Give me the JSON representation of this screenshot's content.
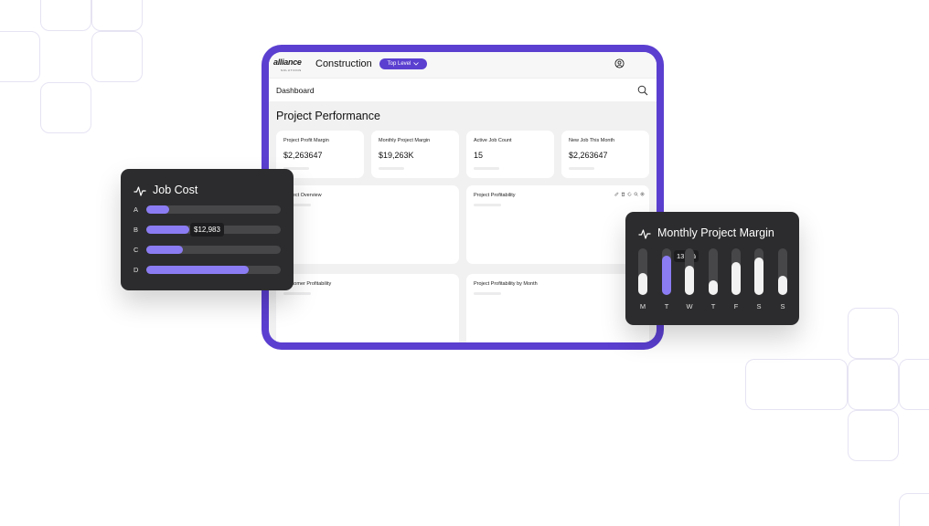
{
  "app": {
    "logo_text": "alliance",
    "logo_subtext": "SOLUTIONS",
    "title": "Construction",
    "level_selector": "Top Level",
    "breadcrumb": "Dashboard",
    "page_title": "Project Performance"
  },
  "kpis": [
    {
      "label": "Project Profit Margin",
      "value": "$2,263647"
    },
    {
      "label": "Monthly Project Margin",
      "value": "$19,263K"
    },
    {
      "label": "Active Job Count",
      "value": "15"
    },
    {
      "label": "New Job This Month",
      "value": "$2,263647"
    }
  ],
  "panels": [
    {
      "title": "Project Overview"
    },
    {
      "title": "Project Profitability"
    },
    {
      "title": "Customer Profitability"
    },
    {
      "title": "Project Profitability by Month"
    }
  ],
  "job_cost": {
    "title": "Job Cost",
    "rows": [
      {
        "label": "A",
        "fill": 0.17
      },
      {
        "label": "B",
        "fill": 0.32,
        "tooltip": "$12,983"
      },
      {
        "label": "C",
        "fill": 0.27
      },
      {
        "label": "D",
        "fill": 0.76
      }
    ]
  },
  "monthly_margin": {
    "title": "Monthly Project Margin",
    "tooltip": "13,8%",
    "days": [
      {
        "label": "M",
        "level": 0.47
      },
      {
        "label": "T",
        "level": 0.84,
        "highlight": true
      },
      {
        "label": "W",
        "level": 0.63
      },
      {
        "label": "T",
        "level": 0.31
      },
      {
        "label": "F",
        "level": 0.71
      },
      {
        "label": "S",
        "level": 0.8
      },
      {
        "label": "S",
        "level": 0.41
      }
    ]
  },
  "colors": {
    "brand": "#5b3fd0",
    "accent_bar": "#8b7cf3",
    "card_dark": "#2c2c2e",
    "track": "#474749"
  }
}
